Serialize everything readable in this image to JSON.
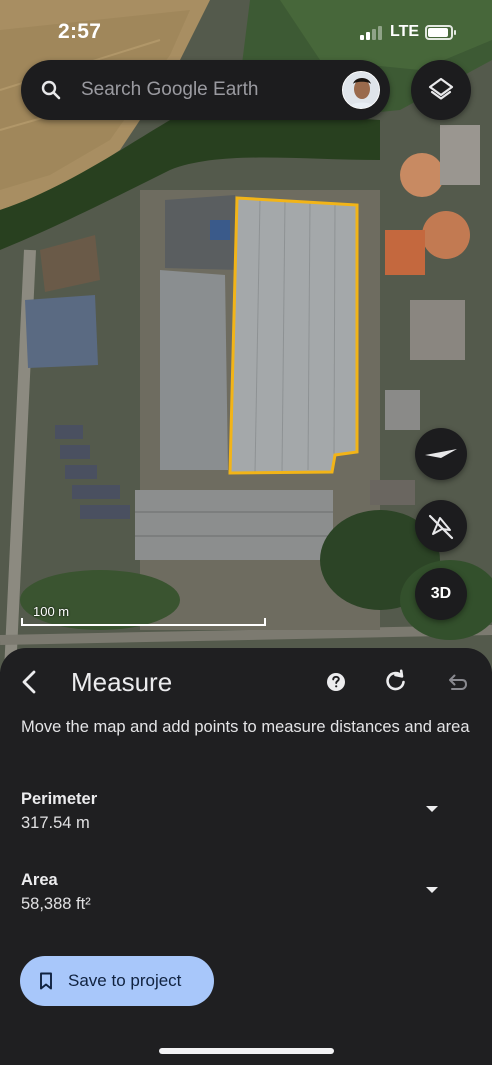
{
  "status_bar": {
    "time": "2:57",
    "network": "LTE",
    "signal_bars_active": 2,
    "signal_bars_total": 4,
    "battery_level": 0.75
  },
  "search": {
    "placeholder": "Search Google Earth",
    "icon": "search-icon"
  },
  "map": {
    "scale_label": "100 m",
    "three_d_label": "3D",
    "measured_outline_color": "#f2b418",
    "controls": [
      "layers-icon",
      "compass-icon",
      "no-fly-icon"
    ]
  },
  "measure_panel": {
    "title": "Measure",
    "instructions": "Move the map and add points to measure distances and area",
    "perimeter": {
      "label": "Perimeter",
      "value": "317.54 m"
    },
    "area": {
      "label": "Area",
      "value": "58,388 ft²"
    },
    "save_button_label": "Save to project",
    "icons": [
      "back-arrow-icon",
      "help-icon",
      "reset-icon",
      "undo-icon",
      "chevron-down-icon",
      "bookmark-icon"
    ]
  },
  "colors": {
    "sheet_background": "#1f1f21",
    "button_accent": "#a8c7fa",
    "outline": "#f2b418"
  }
}
